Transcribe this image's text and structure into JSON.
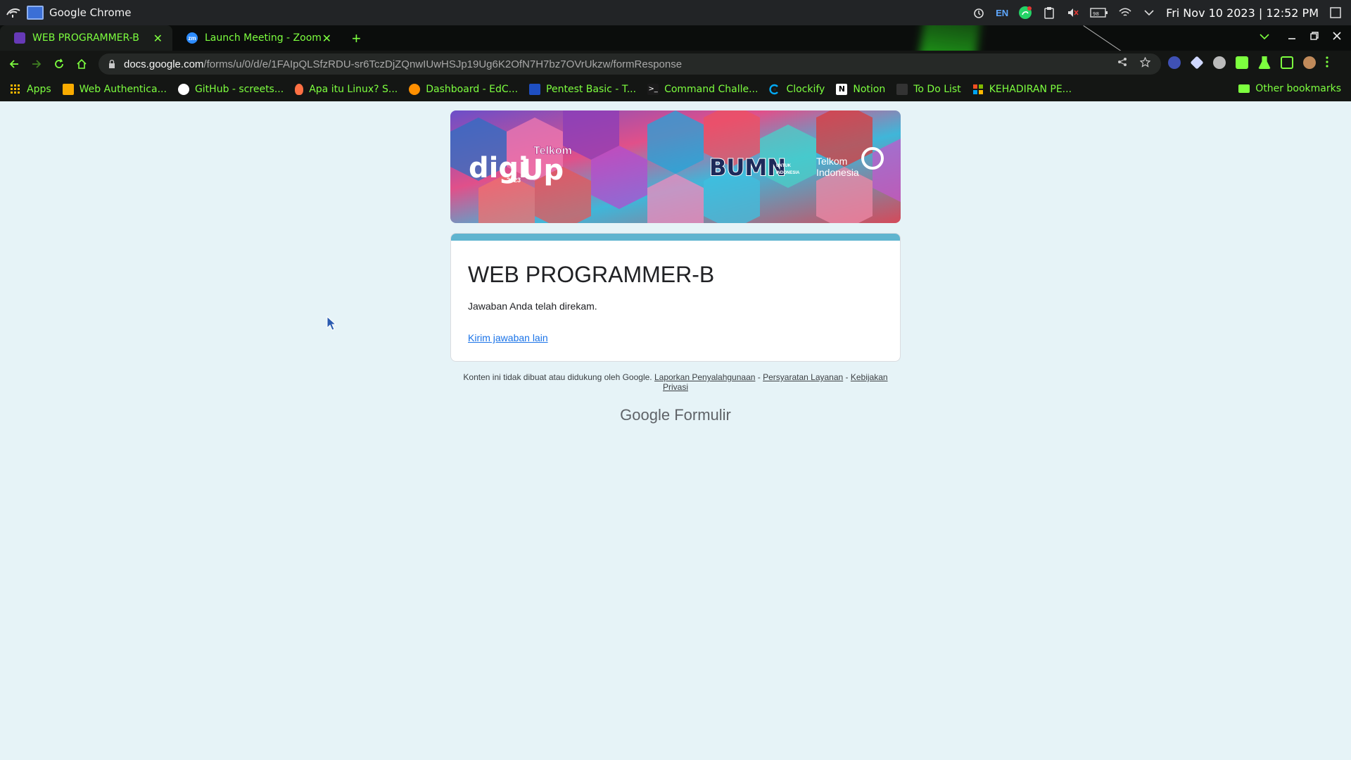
{
  "os": {
    "app_name": "Google Chrome",
    "lang": "EN",
    "battery": "98",
    "clock": "Fri Nov 10 2023 | 12:52 PM"
  },
  "tabs": [
    {
      "title": "WEB PROGRAMMER-B",
      "icon": "google-forms-icon",
      "active": true
    },
    {
      "title": "Launch Meeting - Zoom",
      "icon": "zoom-icon",
      "fav_text": "zm",
      "active": false
    }
  ],
  "address_bar": {
    "host": "docs.google.com",
    "path": "/forms/u/0/d/e/1FAIpQLSfzRDU-sr6TczDjZQnwIUwHSJp19Ug6K2OfN7H7bz7OVrUkzw/formResponse"
  },
  "bookmarks": [
    {
      "label": "Apps",
      "icon": "apps-grid-icon",
      "color": "#f4b400"
    },
    {
      "label": "Web Authentica...",
      "icon": "bookmark-page-icon",
      "color": "#f9ab00"
    },
    {
      "label": "GitHub - screets...",
      "icon": "github-icon",
      "color": "#ffffff"
    },
    {
      "label": "Apa itu Linux? S...",
      "icon": "linux-icon",
      "color": "#ff7043"
    },
    {
      "label": "Dashboard - EdC...",
      "icon": "edc-icon",
      "color": "#ff8f00"
    },
    {
      "label": "Pentest Basic - T...",
      "icon": "bookmark-page-icon",
      "color": "#1e4fc2"
    },
    {
      "label": "Command Challe...",
      "icon": "terminal-icon",
      "color": "#1a1a1a"
    },
    {
      "label": "Clockify",
      "icon": "clockify-icon",
      "color": "#03a9f4"
    },
    {
      "label": "Notion",
      "icon": "notion-icon",
      "color": "#ffffff"
    },
    {
      "label": "To Do List",
      "icon": "todo-icon",
      "color": "#333333"
    },
    {
      "label": "KEHADIRAN PE...",
      "icon": "microsoft-icon",
      "color": "#f25022"
    }
  ],
  "other_bookmarks": "Other bookmarks",
  "form": {
    "title": "WEB PROGRAMMER-B",
    "message": "Jawaban Anda telah direkam.",
    "link": "Kirim jawaban lain"
  },
  "footer": {
    "disclaimer": "Konten ini tidak dibuat atau didukung oleh Google.",
    "report": "Laporkan Penyalahgunaan",
    "sep": " - ",
    "terms": "Persyaratan Layanan",
    "privacy": "Kebijakan Privasi"
  },
  "brand": {
    "google": "Google",
    "formulir": "Formulir"
  },
  "colors": {
    "accent_green": "#7dff3f",
    "form_accent": "#5fb4cf",
    "page_bg": "#e6f3f7"
  }
}
